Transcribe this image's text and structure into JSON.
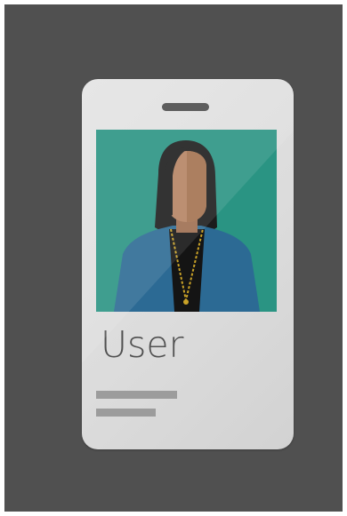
{
  "badge": {
    "label": "User",
    "icon": "id-badge-icon",
    "avatar": "person-avatar-icon",
    "colors": {
      "background": "#505050",
      "card": "#dedede",
      "photo_background": "#2a9483",
      "hair": "#1c1c1c",
      "skin": "#b58362",
      "jacket": "#2c6a94",
      "shirt": "#141414",
      "necklace": "#c9a227",
      "info_lines": "#9c9c9c",
      "slot": "#4b4b4b",
      "label_text": "#505050"
    }
  }
}
